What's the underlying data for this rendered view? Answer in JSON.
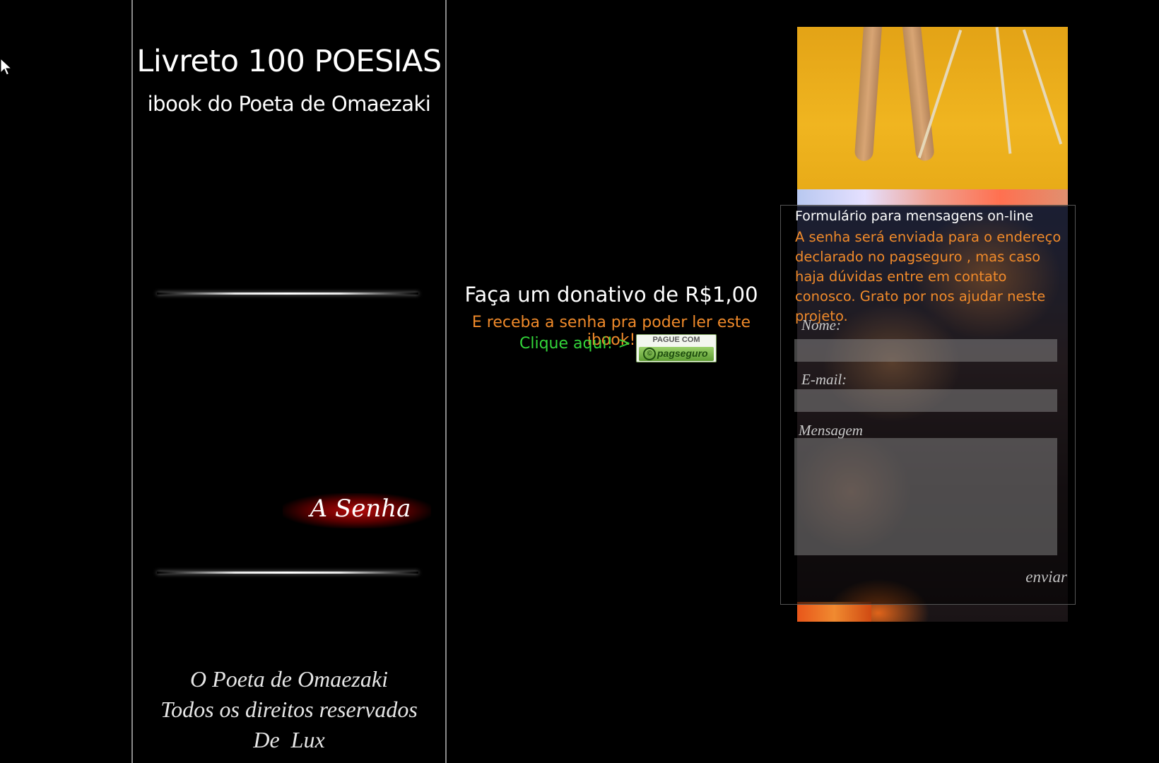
{
  "left_column": {
    "title": "Livreto 100 POESIAS",
    "subtitle": "ibook do Poeta de Omaezaki",
    "password_link": "A Senha",
    "footer_lines": [
      "O Poeta de Omaezaki",
      "Todos os direitos reservados",
      "De  Lux"
    ]
  },
  "donation": {
    "heading": "Faça um donativo de R$1,00",
    "subheading": "E receba a senha pra poder ler este ibook!",
    "click_text": "Clique aqui! >",
    "pay_button_top": "PAGUE COM",
    "pay_button_brand": "pagseguro"
  },
  "contact_form": {
    "title": "Formulário para mensagens on-line",
    "info": "A senha será enviada para o endereço declarado no pagseguro , mas caso haja dúvidas entre em contato conosco. Grato por nos ajudar neste projeto.",
    "name_label": "Nome:",
    "email_label": "E-mail:",
    "message_label": "Mensagem",
    "name_value": "",
    "email_value": "",
    "message_value": "",
    "submit_label": "enviar"
  },
  "colors": {
    "background": "#000000",
    "accent_orange": "#f08a2a",
    "accent_green": "#33d63a",
    "password_glow": "#be0a0a"
  }
}
